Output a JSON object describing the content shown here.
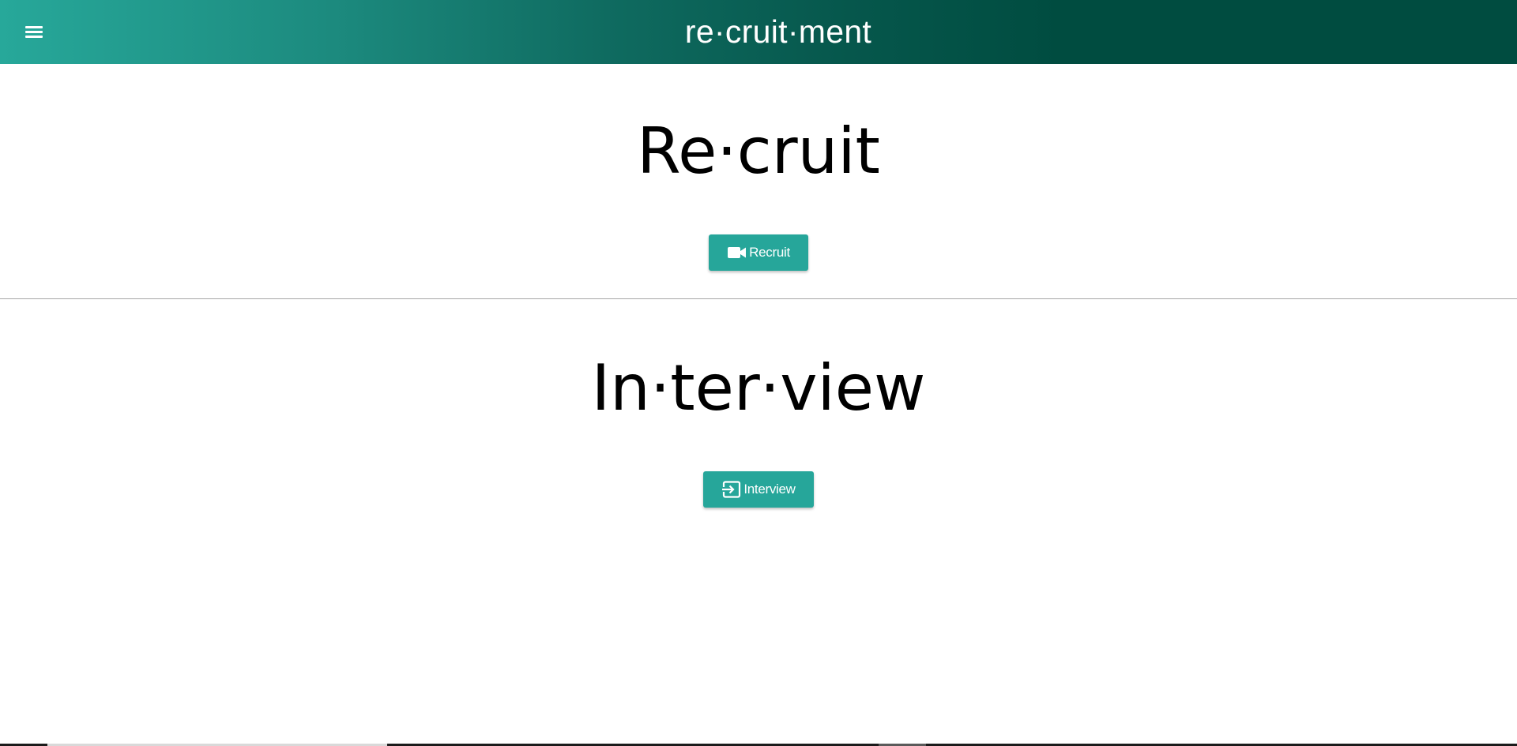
{
  "header": {
    "title": "re·cruit·ment",
    "menu_icon": "hamburger-menu-icon",
    "gradient_colors": [
      "#27a89a",
      "#004c40"
    ]
  },
  "recruit_section": {
    "heading": "Re·cruit",
    "button_label": "Recruit",
    "button_icon": "videocam-icon"
  },
  "interview_section": {
    "heading": "In·ter·view",
    "button_label": "Interview",
    "button_icon": "login-enter-icon"
  },
  "colors": {
    "accent": "#26a69a",
    "header_dark": "#004c40",
    "divider": "#a6a6a6"
  }
}
